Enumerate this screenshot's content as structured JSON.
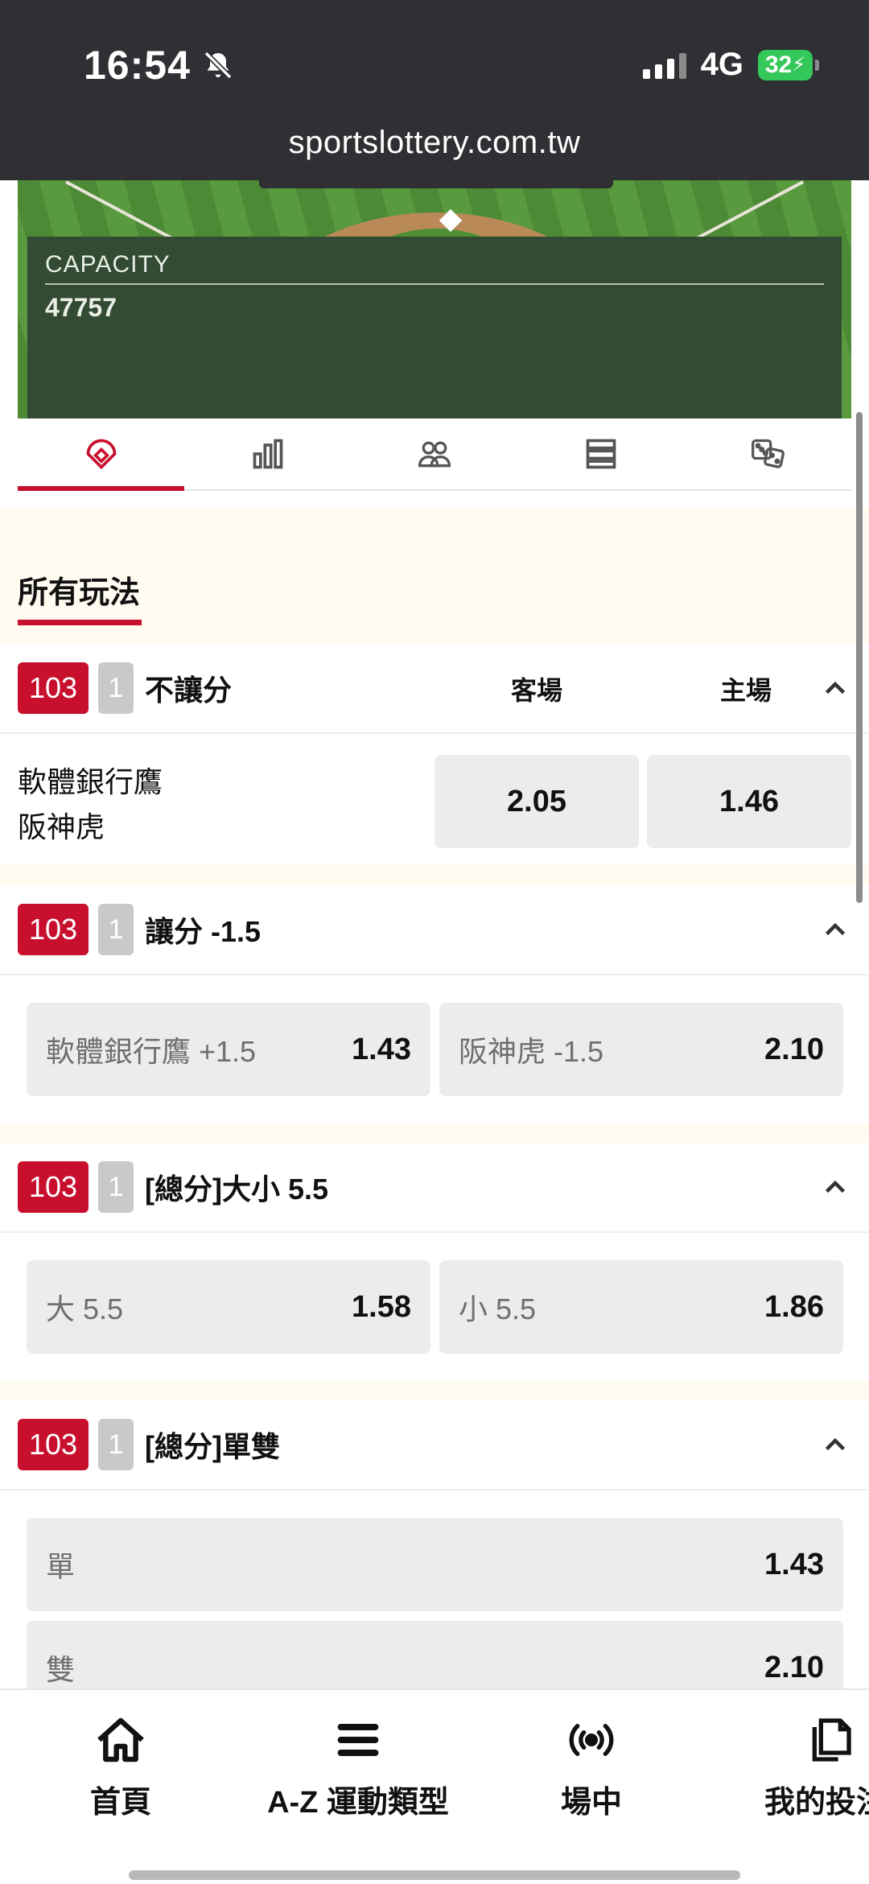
{
  "status_bar": {
    "time": "16:54",
    "network": "4G",
    "battery": "32"
  },
  "browser": {
    "url": "sportslottery.com.tw"
  },
  "venue": {
    "capacity_label": "CAPACITY",
    "capacity_value": "47757"
  },
  "tabs": [
    {
      "icon": "baseball-field-icon",
      "active": true
    },
    {
      "icon": "stats-chart-icon",
      "active": false
    },
    {
      "icon": "lineup-icon",
      "active": false
    },
    {
      "icon": "list-icon",
      "active": false
    },
    {
      "icon": "dice-icon",
      "active": false
    }
  ],
  "section": {
    "title": "所有玩法"
  },
  "markets": [
    {
      "num": "103",
      "set": "1",
      "name": "不讓分",
      "col_away": "客場",
      "col_home": "主場",
      "team_away": "軟體銀行鷹",
      "team_home": "阪神虎",
      "odds_away": "2.05",
      "odds_home": "1.46"
    },
    {
      "num": "103",
      "set": "1",
      "name": "讓分 -1.5",
      "picks": [
        {
          "label": "軟體銀行鷹 +1.5",
          "odds": "1.43"
        },
        {
          "label": "阪神虎 -1.5",
          "odds": "2.10"
        }
      ]
    },
    {
      "num": "103",
      "set": "1",
      "name": "[總分]大小 5.5",
      "picks": [
        {
          "label": "大 5.5",
          "odds": "1.58"
        },
        {
          "label": "小 5.5",
          "odds": "1.86"
        }
      ]
    },
    {
      "num": "103",
      "set": "1",
      "name": "[總分]單雙",
      "picks": [
        {
          "label": "單",
          "odds": "1.43"
        },
        {
          "label": "雙",
          "odds": "2.10"
        }
      ]
    }
  ],
  "bottom_nav": [
    {
      "label": "首頁",
      "icon": "home-icon"
    },
    {
      "label": "A-Z 運動類型",
      "icon": "menu-icon"
    },
    {
      "label": "場中",
      "icon": "live-broadcast-icon"
    },
    {
      "label": "我的投注",
      "icon": "documents-icon"
    }
  ],
  "colors": {
    "accent": "#c8102e",
    "header_bg": "#2e3033",
    "section_bg": "#fffbf1"
  }
}
